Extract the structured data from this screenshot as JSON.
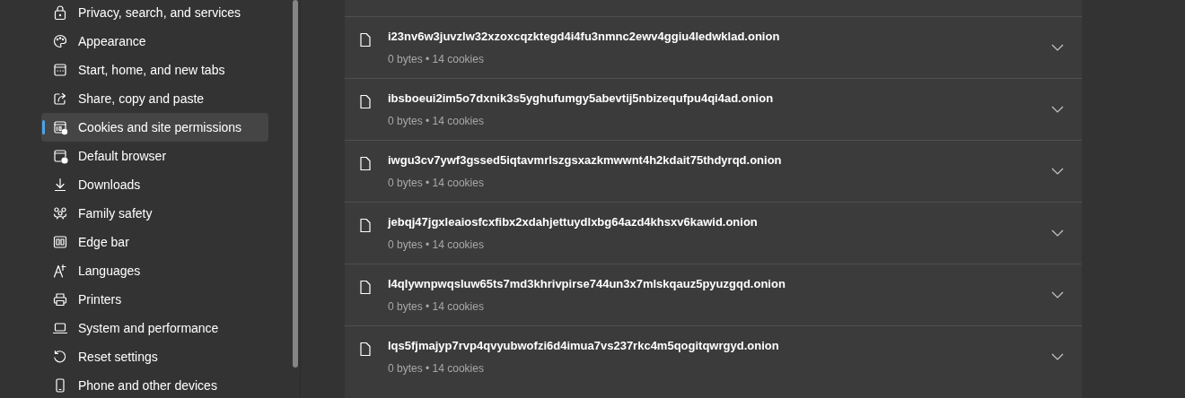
{
  "sidebar": {
    "items": [
      {
        "label": "Privacy, search, and services",
        "selected": false
      },
      {
        "label": "Appearance",
        "selected": false
      },
      {
        "label": "Start, home, and new tabs",
        "selected": false
      },
      {
        "label": "Share, copy and paste",
        "selected": false
      },
      {
        "label": "Cookies and site permissions",
        "selected": true
      },
      {
        "label": "Default browser",
        "selected": false
      },
      {
        "label": "Downloads",
        "selected": false
      },
      {
        "label": "Family safety",
        "selected": false
      },
      {
        "label": "Edge bar",
        "selected": false
      },
      {
        "label": "Languages",
        "selected": false
      },
      {
        "label": "Printers",
        "selected": false
      },
      {
        "label": "System and performance",
        "selected": false
      },
      {
        "label": "Reset settings",
        "selected": false
      },
      {
        "label": "Phone and other devices",
        "selected": false
      }
    ]
  },
  "sites": [
    {
      "name": "i23nv6w3juvzlw32xzoxcqzktegd4i4fu3nmnc2ewv4ggiu4ledwklad.onion",
      "details": "0 bytes • 14 cookies"
    },
    {
      "name": "ibsboeui2im5o7dxnik3s5yghufumgy5abevtij5nbizequfpu4qi4ad.onion",
      "details": "0 bytes • 14 cookies"
    },
    {
      "name": "iwgu3cv7ywf3gssed5iqtavmrlszgsxazkmwwnt4h2kdait75thdyrqd.onion",
      "details": "0 bytes • 14 cookies"
    },
    {
      "name": "jebqj47jgxleaiosfcxfibx2xdahjettuydlxbg64azd4khsxv6kawid.onion",
      "details": "0 bytes • 14 cookies"
    },
    {
      "name": "l4qlywnpwqsluw65ts7md3khrivpirse744un3x7mlskqauz5pyuzgqd.onion",
      "details": "0 bytes • 14 cookies"
    },
    {
      "name": "lqs5fjmajyp7rvp4qvyubwofzi6d4imua7vs237rkc4m5qogitqwrgyd.onion",
      "details": "0 bytes • 14 cookies"
    }
  ]
}
